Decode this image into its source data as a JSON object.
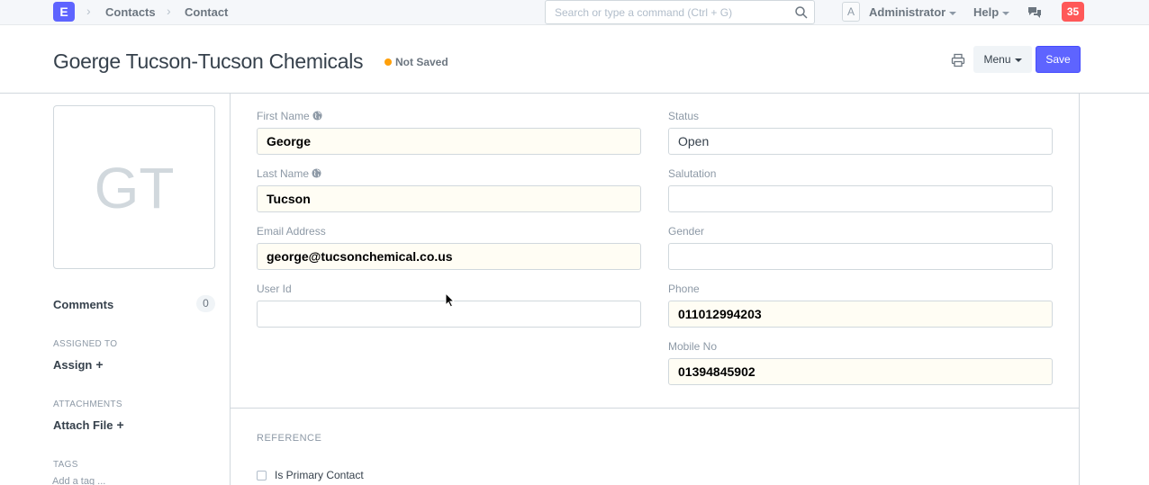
{
  "navbar": {
    "logo": "E",
    "breadcrumbs": [
      "Contacts",
      "Contact"
    ],
    "search_placeholder": "Search or type a command (Ctrl + G)",
    "avatar_letter": "A",
    "user": "Administrator",
    "help": "Help",
    "notifications": "35"
  },
  "header": {
    "title": "Goerge Tucson-Tucson Chemicals",
    "status": "Not Saved",
    "status_color": "#ffa00a",
    "menu_label": "Menu",
    "save_label": "Save",
    "save_color": "#5e64ff"
  },
  "sidebar": {
    "avatar_initials": "GT",
    "comments_label": "Comments",
    "comments_count": "0",
    "assigned_to_label": "ASSIGNED TO",
    "assign_label": "Assign",
    "attachments_label": "ATTACHMENTS",
    "attach_label": "Attach File",
    "tags_label": "TAGS",
    "tag_placeholder": "Add a tag ..."
  },
  "form": {
    "left": [
      {
        "label": "First Name",
        "value": "George",
        "filled": true,
        "globe": true
      },
      {
        "label": "Last Name",
        "value": "Tucson",
        "filled": true,
        "globe": true
      },
      {
        "label": "Email Address",
        "value": "george@tucsonchemical.co.us",
        "filled": true,
        "globe": false
      },
      {
        "label": "User Id",
        "value": "",
        "filled": false,
        "globe": false
      }
    ],
    "right": [
      {
        "label": "Status",
        "value": "Open",
        "filled": false
      },
      {
        "label": "Salutation",
        "value": "",
        "filled": false
      },
      {
        "label": "Gender",
        "value": "",
        "filled": false
      },
      {
        "label": "Phone",
        "value": "011012994203",
        "filled": true
      },
      {
        "label": "Mobile No",
        "value": "01394845902",
        "filled": true
      }
    ],
    "reference_section": "REFERENCE",
    "primary_contact_label": "Is Primary Contact"
  }
}
